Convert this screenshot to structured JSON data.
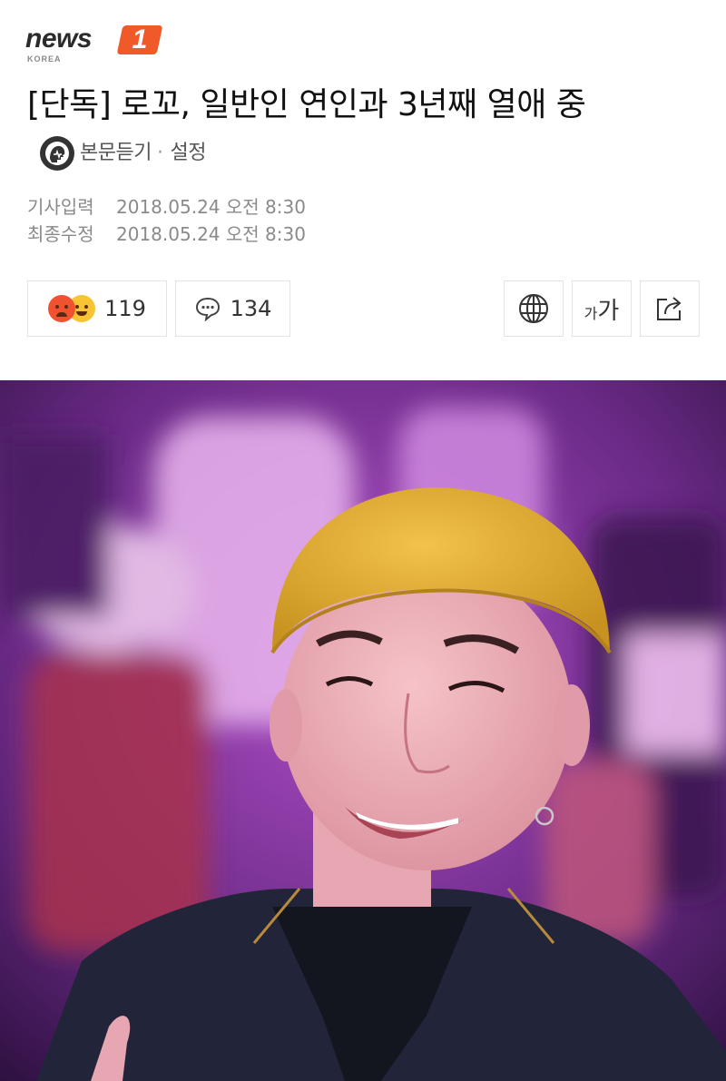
{
  "logo": {
    "word": "news",
    "badge": "1",
    "sub": "KOREA"
  },
  "headline": {
    "title": "[단독] 로꼬, 일반인 연인과 3년째 열애 중",
    "tts_label": "본문듣기",
    "settings_label": "설정"
  },
  "meta": {
    "published_label": "기사입력",
    "published_value": "2018.05.24 오전 8:30",
    "modified_label": "최종수정",
    "modified_value": "2018.05.24 오전 8:30"
  },
  "actions": {
    "reaction_count": "119",
    "comment_count": "134",
    "font_label_small": "가",
    "font_label_large": "가"
  },
  "icons": {
    "tts": "speaker-head-icon",
    "comment": "speech-bubble-icon",
    "translate": "globe-icon",
    "share": "share-icon"
  },
  "colors": {
    "brand": "#f05a28",
    "text": "#111111",
    "meta": "#8a8a8a",
    "border": "#e3e3e3"
  }
}
